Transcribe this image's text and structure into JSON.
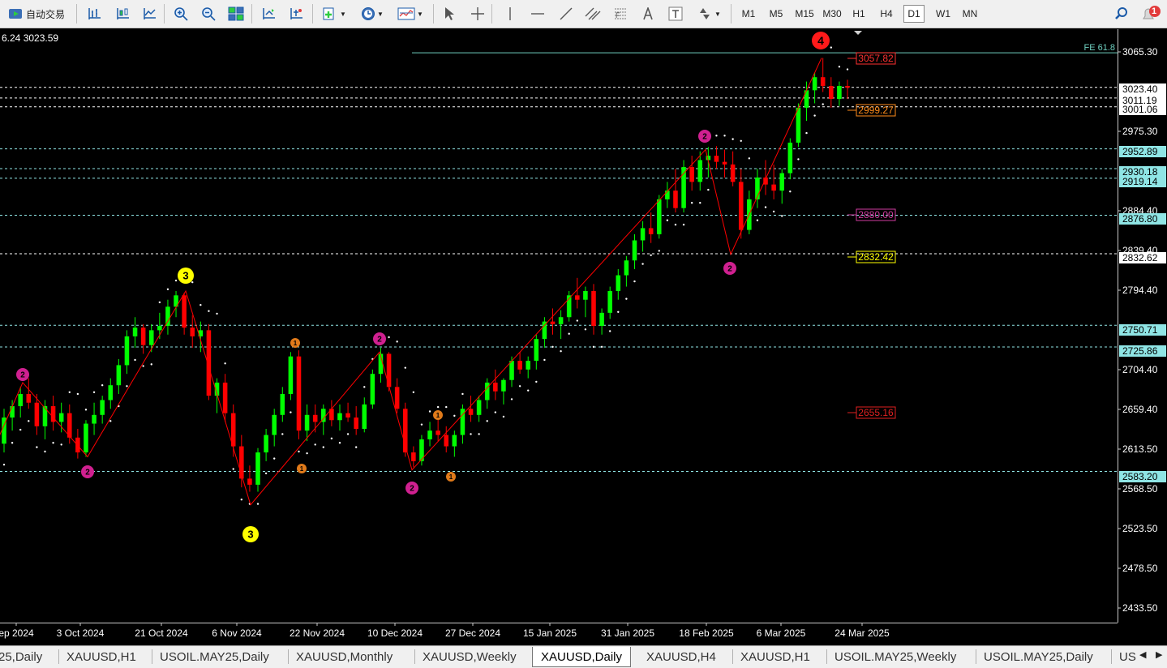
{
  "toolbar": {
    "autotrade_label": "自动交易",
    "timeframes": [
      "M1",
      "M5",
      "M15",
      "M30",
      "H1",
      "H4",
      "D1",
      "W1",
      "MN"
    ],
    "active_timeframe": "D1",
    "notification_count": "1"
  },
  "chart": {
    "symbol_readout": "6.24 3023.59",
    "fe_label": "FE 61.8",
    "wave_labels": {
      "wave4": "4",
      "wave3": "3",
      "wave2": "2",
      "wave1": "1"
    },
    "price_axis_labels": [
      "3065.30",
      "2975.30",
      "2884.40",
      "2839.40",
      "2794.40",
      "2704.40",
      "2659.40",
      "2613.50",
      "2568.50",
      "2523.50",
      "2478.50",
      "2433.50"
    ],
    "highlighted_prices": [
      {
        "value": "3023.40",
        "style": "white"
      },
      {
        "value": "3011.19",
        "style": "white"
      },
      {
        "value": "3001.06",
        "style": "white"
      },
      {
        "value": "2952.89",
        "style": "cyan"
      },
      {
        "value": "2930.18",
        "style": "cyan"
      },
      {
        "value": "2919.14",
        "style": "cyan"
      },
      {
        "value": "2876.80",
        "style": "cyan"
      },
      {
        "value": "2832.62",
        "style": "white"
      },
      {
        "value": "2750.71",
        "style": "cyan"
      },
      {
        "value": "2725.86",
        "style": "cyan"
      },
      {
        "value": "2583.20",
        "style": "cyan"
      }
    ],
    "level_boxes": [
      {
        "value": "3057.82",
        "color": "#ff3030"
      },
      {
        "value": "2999.27",
        "color": "#ff8c1a"
      },
      {
        "value": "2880.00",
        "color": "#d03ca0"
      },
      {
        "value": "2832.42",
        "color": "#ffff00"
      },
      {
        "value": "2655.16",
        "color": "#e02020"
      }
    ],
    "date_labels": [
      "ep 2024",
      "3 Oct 2024",
      "21 Oct 2024",
      "6 Nov 2024",
      "22 Nov 2024",
      "10 Dec 2024",
      "27 Dec 2024",
      "15 Jan 2025",
      "31 Jan 2025",
      "18 Feb 2025",
      "6 Mar 2025",
      "24 Mar 2025"
    ],
    "colors": {
      "bull": "#00ff00",
      "bear": "#ff0000",
      "zigzag": "#ff0000",
      "psar": "#ffffff",
      "background": "#000000"
    }
  },
  "chart_data": {
    "type": "candlestick",
    "symbol": "XAUUSD",
    "timeframe": "D1",
    "ylim": [
      2410,
      3090
    ],
    "candles": [
      [
        2615,
        2655,
        2605,
        2645
      ],
      [
        2645,
        2665,
        2630,
        2658
      ],
      [
        2658,
        2680,
        2645,
        2672
      ],
      [
        2672,
        2690,
        2655,
        2662
      ],
      [
        2662,
        2672,
        2625,
        2635
      ],
      [
        2635,
        2665,
        2620,
        2658
      ],
      [
        2658,
        2670,
        2630,
        2640
      ],
      [
        2640,
        2662,
        2628,
        2650
      ],
      [
        2650,
        2660,
        2615,
        2622
      ],
      [
        2622,
        2632,
        2598,
        2605
      ],
      [
        2605,
        2642,
        2600,
        2638
      ],
      [
        2638,
        2662,
        2625,
        2648
      ],
      [
        2648,
        2670,
        2638,
        2665
      ],
      [
        2665,
        2690,
        2655,
        2682
      ],
      [
        2682,
        2712,
        2672,
        2705
      ],
      [
        2705,
        2745,
        2695,
        2738
      ],
      [
        2738,
        2760,
        2725,
        2748
      ],
      [
        2748,
        2752,
        2718,
        2728
      ],
      [
        2728,
        2752,
        2720,
        2745
      ],
      [
        2745,
        2765,
        2735,
        2750
      ],
      [
        2750,
        2780,
        2740,
        2772
      ],
      [
        2772,
        2790,
        2760,
        2785
      ],
      [
        2785,
        2788,
        2740,
        2748
      ],
      [
        2748,
        2762,
        2725,
        2738
      ],
      [
        2738,
        2755,
        2720,
        2745
      ],
      [
        2745,
        2752,
        2665,
        2670
      ],
      [
        2670,
        2690,
        2650,
        2685
      ],
      [
        2685,
        2695,
        2640,
        2650
      ],
      [
        2650,
        2660,
        2600,
        2612
      ],
      [
        2612,
        2625,
        2565,
        2575
      ],
      [
        2575,
        2590,
        2560,
        2568
      ],
      [
        2568,
        2610,
        2560,
        2605
      ],
      [
        2605,
        2632,
        2595,
        2625
      ],
      [
        2625,
        2655,
        2612,
        2648
      ],
      [
        2648,
        2680,
        2640,
        2672
      ],
      [
        2672,
        2720,
        2665,
        2715
      ],
      [
        2715,
        2722,
        2620,
        2630
      ],
      [
        2630,
        2660,
        2618,
        2648
      ],
      [
        2648,
        2660,
        2628,
        2640
      ],
      [
        2640,
        2660,
        2625,
        2655
      ],
      [
        2655,
        2665,
        2635,
        2642
      ],
      [
        2642,
        2660,
        2630,
        2650
      ],
      [
        2650,
        2662,
        2640,
        2645
      ],
      [
        2645,
        2658,
        2625,
        2632
      ],
      [
        2632,
        2668,
        2628,
        2660
      ],
      [
        2660,
        2700,
        2655,
        2695
      ],
      [
        2695,
        2725,
        2685,
        2718
      ],
      [
        2718,
        2720,
        2675,
        2680
      ],
      [
        2680,
        2690,
        2650,
        2655
      ],
      [
        2655,
        2662,
        2600,
        2605
      ],
      [
        2605,
        2612,
        2588,
        2595
      ],
      [
        2595,
        2625,
        2590,
        2620
      ],
      [
        2620,
        2640,
        2612,
        2630
      ],
      [
        2630,
        2645,
        2618,
        2625
      ],
      [
        2625,
        2635,
        2605,
        2612
      ],
      [
        2612,
        2630,
        2600,
        2625
      ],
      [
        2625,
        2660,
        2615,
        2655
      ],
      [
        2655,
        2670,
        2640,
        2648
      ],
      [
        2648,
        2670,
        2640,
        2665
      ],
      [
        2665,
        2690,
        2655,
        2685
      ],
      [
        2685,
        2700,
        2665,
        2675
      ],
      [
        2675,
        2690,
        2660,
        2688
      ],
      [
        2688,
        2715,
        2680,
        2710
      ],
      [
        2710,
        2720,
        2695,
        2700
      ],
      [
        2700,
        2715,
        2690,
        2710
      ],
      [
        2710,
        2740,
        2700,
        2735
      ],
      [
        2735,
        2760,
        2725,
        2755
      ],
      [
        2755,
        2770,
        2740,
        2752
      ],
      [
        2752,
        2768,
        2735,
        2760
      ],
      [
        2760,
        2790,
        2755,
        2785
      ],
      [
        2785,
        2805,
        2770,
        2780
      ],
      [
        2780,
        2795,
        2760,
        2790
      ],
      [
        2790,
        2798,
        2740,
        2750
      ],
      [
        2750,
        2770,
        2740,
        2765
      ],
      [
        2765,
        2795,
        2758,
        2790
      ],
      [
        2790,
        2815,
        2780,
        2808
      ],
      [
        2808,
        2830,
        2795,
        2825
      ],
      [
        2825,
        2855,
        2815,
        2848
      ],
      [
        2848,
        2870,
        2835,
        2862
      ],
      [
        2862,
        2880,
        2845,
        2855
      ],
      [
        2855,
        2900,
        2850,
        2895
      ],
      [
        2895,
        2915,
        2885,
        2905
      ],
      [
        2905,
        2930,
        2880,
        2885
      ],
      [
        2885,
        2940,
        2880,
        2932
      ],
      [
        2932,
        2945,
        2905,
        2915
      ],
      [
        2915,
        2950,
        2905,
        2940
      ],
      [
        2940,
        2955,
        2920,
        2945
      ],
      [
        2945,
        2956,
        2930,
        2938
      ],
      [
        2938,
        2952,
        2920,
        2935
      ],
      [
        2935,
        2950,
        2910,
        2915
      ],
      [
        2915,
        2930,
        2850,
        2860
      ],
      [
        2860,
        2905,
        2855,
        2895
      ],
      [
        2895,
        2930,
        2885,
        2920
      ],
      [
        2920,
        2940,
        2900,
        2912
      ],
      [
        2912,
        2935,
        2895,
        2905
      ],
      [
        2905,
        2930,
        2890,
        2925
      ],
      [
        2925,
        2965,
        2918,
        2960
      ],
      [
        2960,
        3005,
        2955,
        3000
      ],
      [
        3000,
        3030,
        2985,
        3020
      ],
      [
        3020,
        3040,
        3005,
        3035
      ],
      [
        3035,
        3057,
        3018,
        3025
      ],
      [
        3025,
        3035,
        3000,
        3010
      ],
      [
        3010,
        3030,
        3002,
        3025
      ],
      [
        3025,
        3032,
        3010,
        3023
      ]
    ]
  }
}
